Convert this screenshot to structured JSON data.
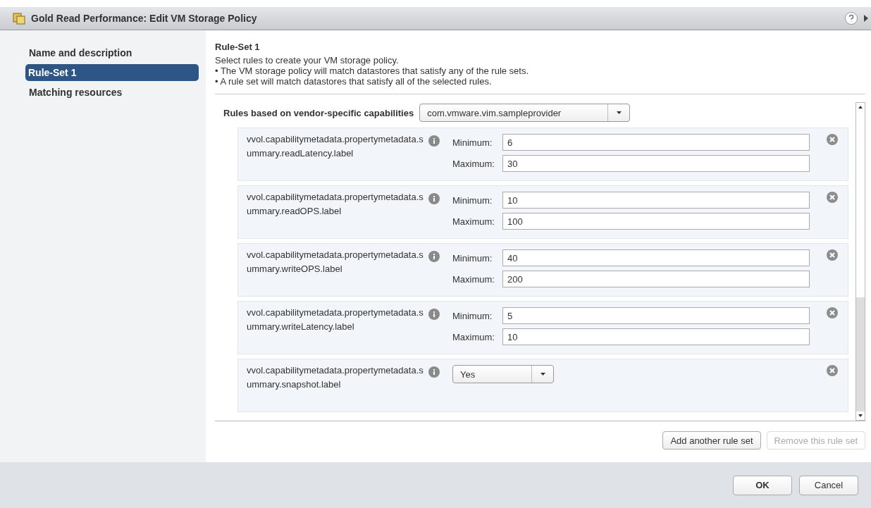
{
  "window": {
    "title": "Gold Read Performance: Edit VM Storage Policy"
  },
  "sidebar": {
    "items": [
      {
        "label": "Name and description",
        "selected": false
      },
      {
        "label": "Rule-Set 1",
        "selected": true
      },
      {
        "label": "Matching resources",
        "selected": false
      }
    ]
  },
  "rule_set": {
    "title": "Rule-Set 1",
    "intro": "Select rules to create your VM storage policy.",
    "bullets": [
      "• The VM storage policy will match datastores that satisfy any of the rule sets.",
      "• A rule set will match datastores that satisfy all of the selected rules."
    ]
  },
  "vendor": {
    "label": "Rules based on vendor-specific capabilities",
    "value": "com.vmware.vim.sampleprovider"
  },
  "rules": [
    {
      "kind": "range",
      "name": "vvol.capabilitymetadata.propertymetadata.summary.readLatency.label",
      "minimum_label": "Minimum:",
      "minimum": "6",
      "maximum_label": "Maximum:",
      "maximum": "30"
    },
    {
      "kind": "range",
      "name": "vvol.capabilitymetadata.propertymetadata.summary.readOPS.label",
      "minimum_label": "Minimum:",
      "minimum": "10",
      "maximum_label": "Maximum:",
      "maximum": "100"
    },
    {
      "kind": "range",
      "name": "vvol.capabilitymetadata.propertymetadata.summary.writeOPS.label",
      "minimum_label": "Minimum:",
      "minimum": "40",
      "maximum_label": "Maximum:",
      "maximum": "200"
    },
    {
      "kind": "range",
      "name": "vvol.capabilitymetadata.propertymetadata.summary.writeLatency.label",
      "minimum_label": "Minimum:",
      "minimum": "5",
      "maximum_label": "Maximum:",
      "maximum": "10"
    },
    {
      "kind": "choice",
      "name": "vvol.capabilitymetadata.propertymetadata.summary.snapshot.label",
      "value": "Yes"
    }
  ],
  "rule_set_buttons": [
    {
      "label": "Add another rule set",
      "disabled": false
    },
    {
      "label": "Remove this rule set",
      "disabled": true
    }
  ],
  "dialog_buttons": [
    {
      "label": "OK",
      "kind": "primary"
    },
    {
      "label": "Cancel",
      "kind": "normal"
    }
  ]
}
